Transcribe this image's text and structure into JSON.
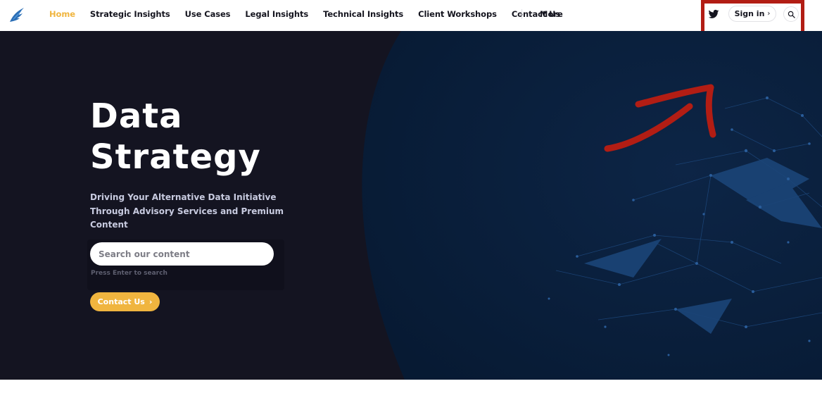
{
  "nav": {
    "logo_icon": "bird-logo-icon",
    "links": [
      {
        "label": "Home",
        "active": true
      },
      {
        "label": "Strategic Insights",
        "active": false
      },
      {
        "label": "Use Cases",
        "active": false
      },
      {
        "label": "Legal Insights",
        "active": false
      },
      {
        "label": "Technical Insights",
        "active": false
      },
      {
        "label": "Client Workshops",
        "active": false
      },
      {
        "label": "Contact Us",
        "active": false
      }
    ],
    "more_label": "More",
    "twitter_icon": "twitter-icon",
    "signin_label": "Sign in",
    "signin_chevron": "›",
    "search_icon": "search-icon"
  },
  "hero": {
    "title_line1": "Data",
    "title_line2": "Strategy",
    "subtitle": "Driving Your Alternative Data Initiative Through Advisory Services and Premium Content",
    "search_placeholder": "Search our content",
    "search_hint": "Press Enter to search",
    "contact_label": "Contact Us",
    "contact_chevron": "›"
  },
  "colors": {
    "accent": "#f0b53f",
    "nav_text": "#15151f",
    "hero_bg_dark": "#141421",
    "hero_bg_blue": "#0b1d38",
    "annotation_red": "#b21d14"
  }
}
